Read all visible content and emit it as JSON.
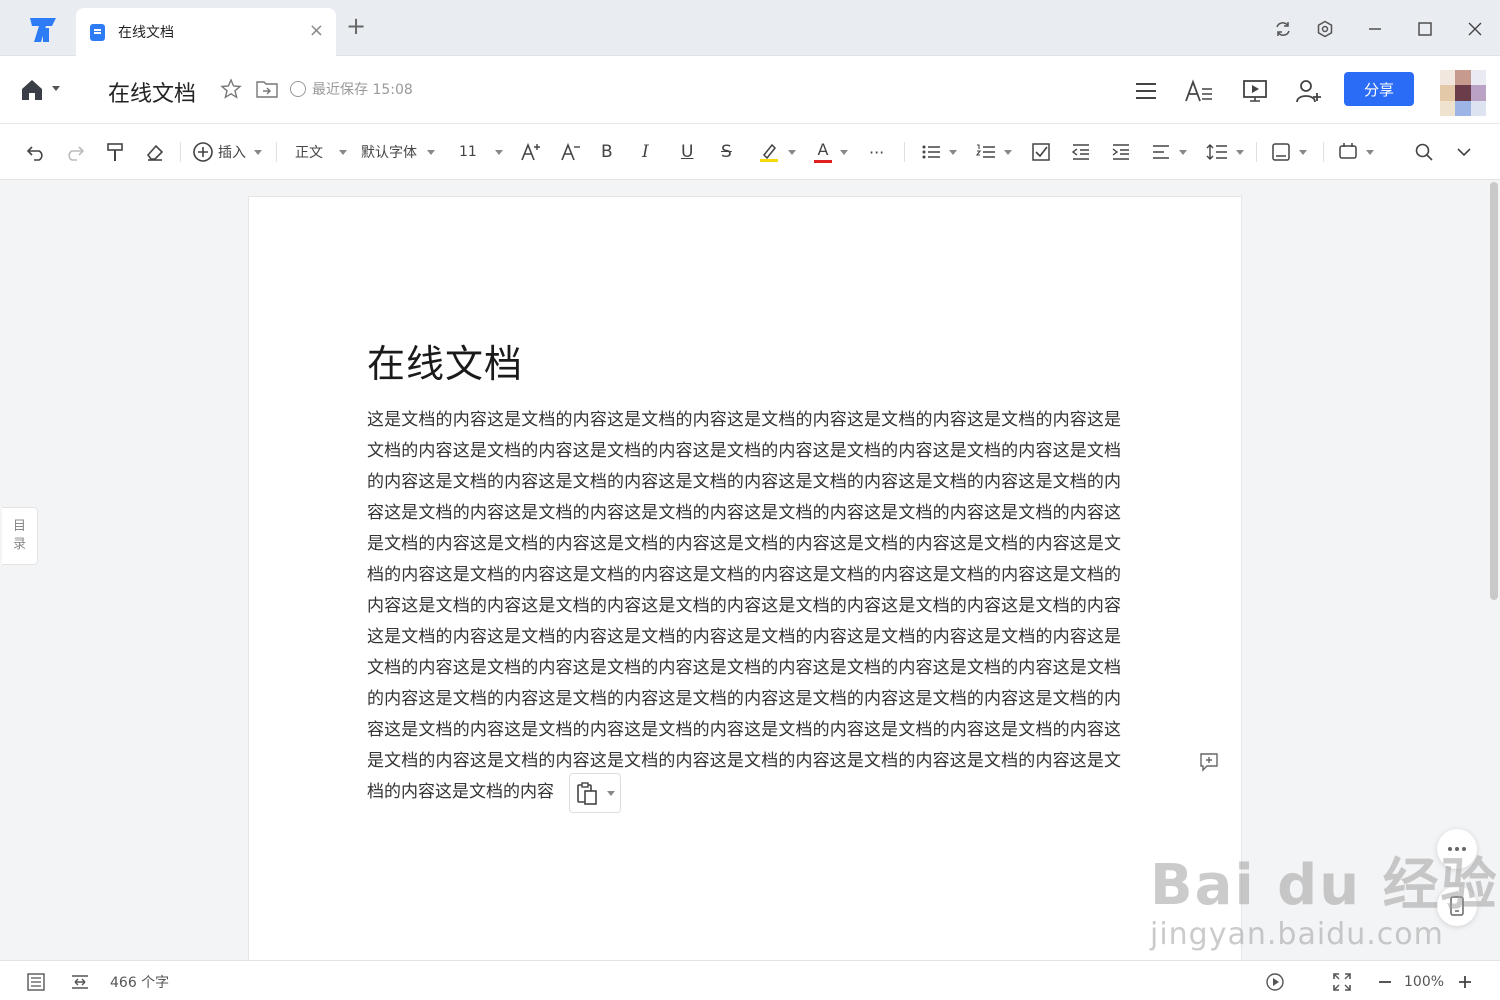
{
  "tab": {
    "title": "在线文档"
  },
  "header": {
    "doc_title": "在线文档",
    "save_status": "最近保存 15:08",
    "share_label": "分享"
  },
  "toolbar": {
    "insert_label": "插入",
    "style_label": "正文",
    "font_label": "默认字体",
    "size_label": "11",
    "bold_label": "B",
    "italic_label": "I",
    "underline_label": "U",
    "strike_label": "S",
    "font_color_label": "A",
    "more_label": "···"
  },
  "toc": {
    "label_1": "目",
    "label_2": "录"
  },
  "document": {
    "title": "在线文档",
    "body": "这是文档的内容这是文档的内容这是文档的内容这是文档的内容这是文档的内容这是文档的内容这是文档的内容这是文档的内容这是文档的内容这是文档的内容这是文档的内容这是文档的内容这是文档的内容这是文档的内容这是文档的内容这是文档的内容这是文档的内容这是文档的内容这是文档的内容这是文档的内容这是文档的内容这是文档的内容这是文档的内容这是文档的内容这是文档的内容这是文档的内容这是文档的内容这是文档的内容这是文档的内容这是文档的内容这是文档的内容这是文档的内容这是文档的内容这是文档的内容这是文档的内容这是文档的内容这是文档的内容这是文档的内容这是文档的内容这是文档的内容这是文档的内容这是文档的内容这是文档的内容这是文档的内容这是文档的内容这是文档的内容这是文档的内容这是文档的内容这是文档的内容这是文档的内容这是文档的内容这是文档的内容这是文档的内容这是文档的内容这是文档的内容这是文档的内容这是文档的内容这是文档的内容这是文档的内容这是文档的内容这是文档的内容这是文档的内容这是文档的内容这是文档的内容这是文档的内容这是文档的内容这是文档的内容这是文档的内容这是文档的内容这是文档的内容这是文档的内容这是文档的内容这是文档的内容这是文档的内容这是文档的内容这是文档的内容这是文档的内容"
  },
  "status": {
    "word_count": "466 个字",
    "zoom": "100%"
  },
  "watermark": {
    "main": "Bai du 经验",
    "sub": "jingyan.baidu.com"
  },
  "colors": {
    "accent": "#2b6cf6",
    "highlight": "#f5d90a",
    "font_color": "#e02020"
  },
  "icons": [
    "app-logo",
    "doc-icon",
    "close-icon",
    "plus-icon",
    "refresh-icon",
    "gear-icon",
    "minimize-icon",
    "maximize-icon",
    "window-close-icon",
    "home-icon",
    "star-icon",
    "folder-move-icon",
    "menu-icon",
    "text-style-icon",
    "present-icon",
    "add-user-icon",
    "undo-icon",
    "redo-icon",
    "format-painter-icon",
    "eraser-icon",
    "bullet-list-icon",
    "numbered-list-icon",
    "checkbox-icon",
    "outdent-icon",
    "indent-icon",
    "align-icon",
    "line-spacing-icon",
    "card-icon",
    "view-icon",
    "search-icon",
    "chevron-down-icon",
    "paste-icon",
    "comment-add-icon",
    "more-icon",
    "mobile-icon",
    "outline-icon",
    "page-width-icon",
    "play-icon",
    "fullscreen-icon",
    "zoom-out-icon",
    "zoom-in-icon"
  ]
}
